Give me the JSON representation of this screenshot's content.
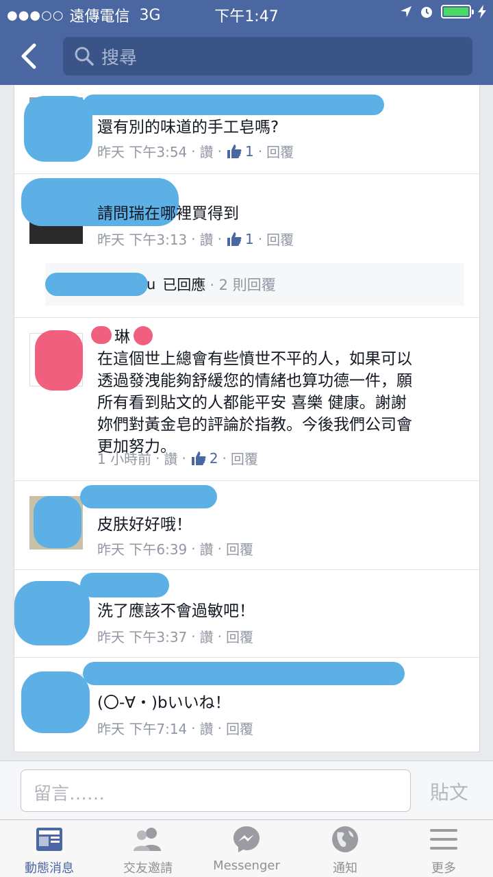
{
  "status_bar": {
    "signal": "●●●○○",
    "carrier": "遠傳電信",
    "network": "3G",
    "time": "下午1:47"
  },
  "nav": {
    "search_placeholder": "搜尋"
  },
  "comments": [
    {
      "text": "還有別的味道的手工皂嗎?",
      "time": "昨天 下午3:54",
      "like_label": "讚",
      "like_count": "1",
      "reply_label": "回覆"
    },
    {
      "text": "請問瑞在哪裡買得到",
      "time": "昨天 下午3:13",
      "like_label": "讚",
      "like_count": "1",
      "reply_label": "回覆",
      "replies": {
        "author_fragment": "u",
        "label": "已回應",
        "count": "· 2 則回覆"
      }
    },
    {
      "name_fragment": "琳",
      "lines": [
        "在這個世上總會有些憤世不平的人，如果可以",
        "透過發洩能夠舒緩您的情緒也算功德一件，願",
        "所有看到貼文的人都能平安 喜樂 健康。謝謝",
        "妳們對黃金皂的評論於指教。今後我們公司會",
        "更加努力。"
      ],
      "time": "1 小時前",
      "like_label": "讚",
      "like_count": "2",
      "reply_label": "回覆"
    },
    {
      "text": "皮肤好好哦！",
      "time": "昨天 下午6:39",
      "like_label": "讚",
      "reply_label": "回覆"
    },
    {
      "text": "洗了應該不會過敏吧！",
      "time": "昨天 下午3:37",
      "like_label": "讚",
      "reply_label": "回覆"
    },
    {
      "text": "(〇-∀・)bいいね！",
      "time": "昨天 下午7:14",
      "like_label": "讚",
      "reply_label": "回覆"
    }
  ],
  "compose": {
    "placeholder": "留言……",
    "post_label": "貼文"
  },
  "tabs": [
    {
      "label": "動態消息",
      "icon": "news-feed-icon",
      "active": true
    },
    {
      "label": "交友邀請",
      "icon": "friends-icon",
      "active": false
    },
    {
      "label": "Messenger",
      "icon": "messenger-icon",
      "active": false
    },
    {
      "label": "通知",
      "icon": "globe-icon",
      "active": false
    },
    {
      "label": "更多",
      "icon": "menu-icon",
      "active": false
    }
  ],
  "colors": {
    "header": "#4b67a1",
    "link": "#4b67a1",
    "muted": "#9197a3",
    "redaction": "#5cb0e6"
  }
}
